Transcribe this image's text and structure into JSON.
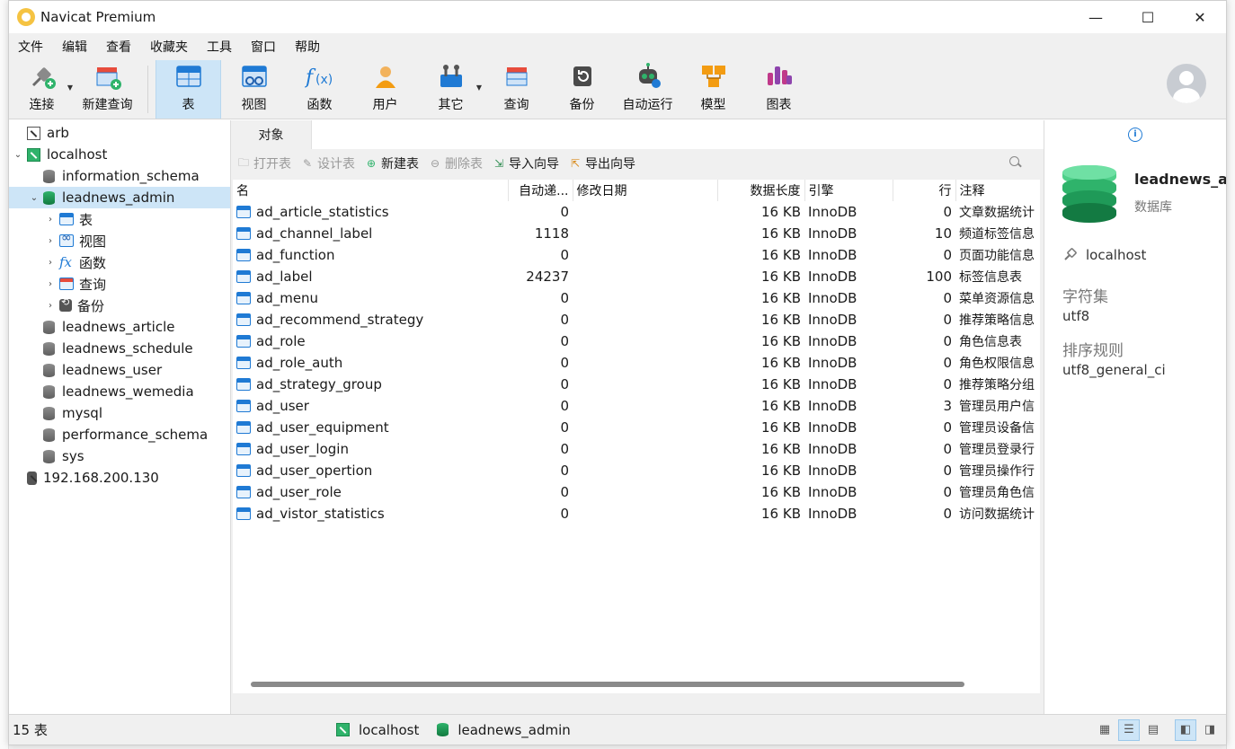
{
  "window": {
    "title": "Navicat Premium",
    "minimize": "—",
    "maximize": "☐",
    "close": "✕"
  },
  "menu": [
    "文件",
    "编辑",
    "查看",
    "收藏夹",
    "工具",
    "窗口",
    "帮助"
  ],
  "toolbar": [
    {
      "label": "连接",
      "icon": "connect-icon",
      "dropdown": true
    },
    {
      "label": "新建查询",
      "icon": "new-query-icon"
    },
    {
      "label": "表",
      "icon": "table-icon",
      "active": true
    },
    {
      "label": "视图",
      "icon": "view-icon"
    },
    {
      "label": "函数",
      "icon": "function-icon"
    },
    {
      "label": "用户",
      "icon": "user-icon"
    },
    {
      "label": "其它",
      "icon": "other-icon",
      "dropdown": true
    },
    {
      "label": "查询",
      "icon": "query-icon"
    },
    {
      "label": "备份",
      "icon": "backup-icon"
    },
    {
      "label": "自动运行",
      "icon": "robot-icon"
    },
    {
      "label": "模型",
      "icon": "model-icon"
    },
    {
      "label": "图表",
      "icon": "chart-icon"
    }
  ],
  "tree": {
    "arb": "arb",
    "localhost": "localhost",
    "information_schema": "information_schema",
    "leadnews_admin": "leadnews_admin",
    "children": {
      "tables": "表",
      "views": "视图",
      "functions": "函数",
      "queries": "查询",
      "backups": "备份"
    },
    "others": [
      "leadnews_article",
      "leadnews_schedule",
      "leadnews_user",
      "leadnews_wemedia",
      "mysql",
      "performance_schema",
      "sys"
    ],
    "ip": "192.168.200.130"
  },
  "tabs": {
    "objects": "对象"
  },
  "objectbar": {
    "open": "打开表",
    "design": "设计表",
    "new": "新建表",
    "delete": "删除表",
    "import": "导入向导",
    "export": "导出向导"
  },
  "columns": {
    "name": "名",
    "auto_inc": "自动递...",
    "modified": "修改日期",
    "data_length": "数据长度",
    "engine": "引擎",
    "rows": "行",
    "comment": "注释"
  },
  "tables": [
    {
      "name": "ad_article_statistics",
      "auto_inc": "0",
      "modified": "",
      "size": "16 KB",
      "engine": "InnoDB",
      "rows": "0",
      "comment": "文章数据统计"
    },
    {
      "name": "ad_channel_label",
      "auto_inc": "1118",
      "modified": "",
      "size": "16 KB",
      "engine": "InnoDB",
      "rows": "10",
      "comment": "频道标签信息"
    },
    {
      "name": "ad_function",
      "auto_inc": "0",
      "modified": "",
      "size": "16 KB",
      "engine": "InnoDB",
      "rows": "0",
      "comment": "页面功能信息"
    },
    {
      "name": "ad_label",
      "auto_inc": "24237",
      "modified": "",
      "size": "16 KB",
      "engine": "InnoDB",
      "rows": "100",
      "comment": "标签信息表"
    },
    {
      "name": "ad_menu",
      "auto_inc": "0",
      "modified": "",
      "size": "16 KB",
      "engine": "InnoDB",
      "rows": "0",
      "comment": "菜单资源信息"
    },
    {
      "name": "ad_recommend_strategy",
      "auto_inc": "0",
      "modified": "",
      "size": "16 KB",
      "engine": "InnoDB",
      "rows": "0",
      "comment": "推荐策略信息"
    },
    {
      "name": "ad_role",
      "auto_inc": "0",
      "modified": "",
      "size": "16 KB",
      "engine": "InnoDB",
      "rows": "0",
      "comment": "角色信息表"
    },
    {
      "name": "ad_role_auth",
      "auto_inc": "0",
      "modified": "",
      "size": "16 KB",
      "engine": "InnoDB",
      "rows": "0",
      "comment": "角色权限信息"
    },
    {
      "name": "ad_strategy_group",
      "auto_inc": "0",
      "modified": "",
      "size": "16 KB",
      "engine": "InnoDB",
      "rows": "0",
      "comment": "推荐策略分组"
    },
    {
      "name": "ad_user",
      "auto_inc": "0",
      "modified": "",
      "size": "16 KB",
      "engine": "InnoDB",
      "rows": "3",
      "comment": "管理员用户信"
    },
    {
      "name": "ad_user_equipment",
      "auto_inc": "0",
      "modified": "",
      "size": "16 KB",
      "engine": "InnoDB",
      "rows": "0",
      "comment": "管理员设备信"
    },
    {
      "name": "ad_user_login",
      "auto_inc": "0",
      "modified": "",
      "size": "16 KB",
      "engine": "InnoDB",
      "rows": "0",
      "comment": "管理员登录行"
    },
    {
      "name": "ad_user_opertion",
      "auto_inc": "0",
      "modified": "",
      "size": "16 KB",
      "engine": "InnoDB",
      "rows": "0",
      "comment": "管理员操作行"
    },
    {
      "name": "ad_user_role",
      "auto_inc": "0",
      "modified": "",
      "size": "16 KB",
      "engine": "InnoDB",
      "rows": "0",
      "comment": "管理员角色信"
    },
    {
      "name": "ad_vistor_statistics",
      "auto_inc": "0",
      "modified": "",
      "size": "16 KB",
      "engine": "InnoDB",
      "rows": "0",
      "comment": "访问数据统计"
    }
  ],
  "info": {
    "db_name": "leadnews_a",
    "db_type": "数据库",
    "host": "localhost",
    "charset_label": "字符集",
    "charset": "utf8",
    "collation_label": "排序规则",
    "collation": "utf8_general_ci"
  },
  "status": {
    "count": "15 表",
    "connection": "localhost",
    "database": "leadnews_admin"
  },
  "colors": {
    "accent": "#1f7ad4",
    "selection": "#cde5f7",
    "db_green": "#1b9a55"
  }
}
